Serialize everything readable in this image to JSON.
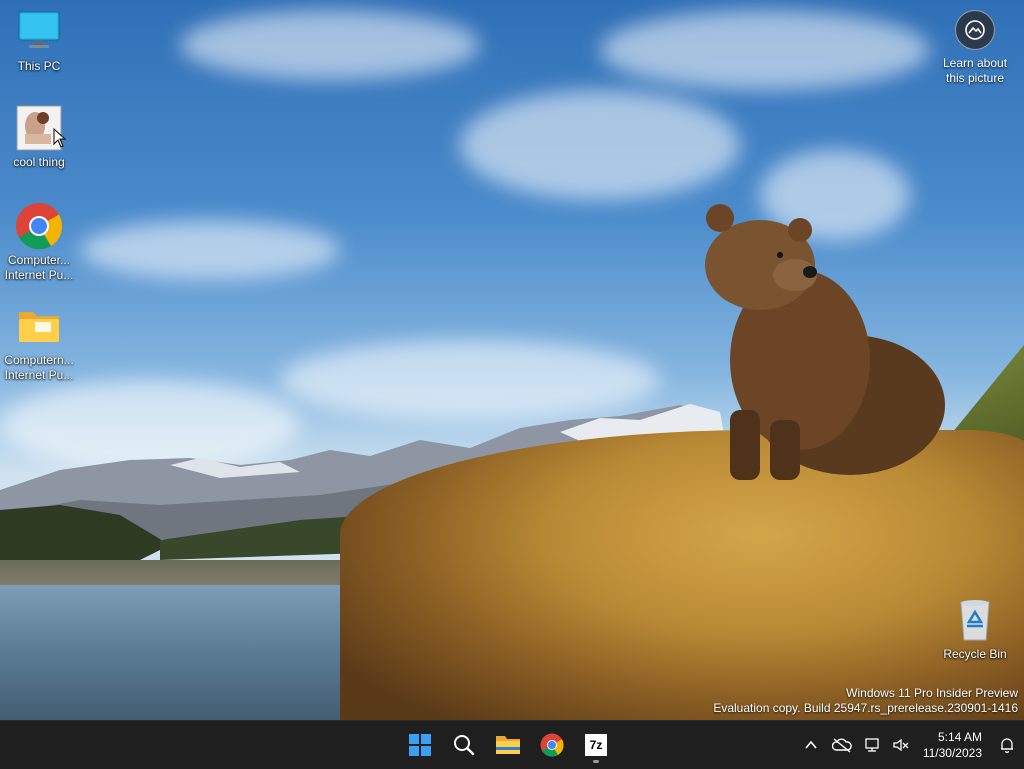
{
  "desktop_icons": [
    {
      "label": "This PC",
      "icon": "monitor-icon"
    },
    {
      "label": "cool thing",
      "icon": "image-thumbnail-icon"
    },
    {
      "label_line1": "Computer...",
      "label_line2": "Internet Pu...",
      "icon": "chrome-icon"
    },
    {
      "label_line1": "Computern...",
      "label_line2": "Internet Pu...",
      "icon": "folder-icon"
    },
    {
      "label": "Recycle Bin",
      "icon": "recycle-bin-icon"
    }
  ],
  "learn_about": {
    "line1": "Learn about",
    "line2": "this picture"
  },
  "watermark": {
    "line1": "Windows 11 Pro Insider Preview",
    "line2": "Evaluation copy. Build 25947.rs_prerelease.230901-1416"
  },
  "taskbar": {
    "apps": [
      "start-icon",
      "search-icon",
      "file-explorer-icon",
      "chrome-icon",
      "7zip-icon"
    ],
    "sevenzip_label": "7z"
  },
  "clock": {
    "time": "5:14 AM",
    "date": "11/30/2023"
  },
  "colors": {
    "taskbar": "#1f1f1f",
    "accent": "#0078d4"
  }
}
